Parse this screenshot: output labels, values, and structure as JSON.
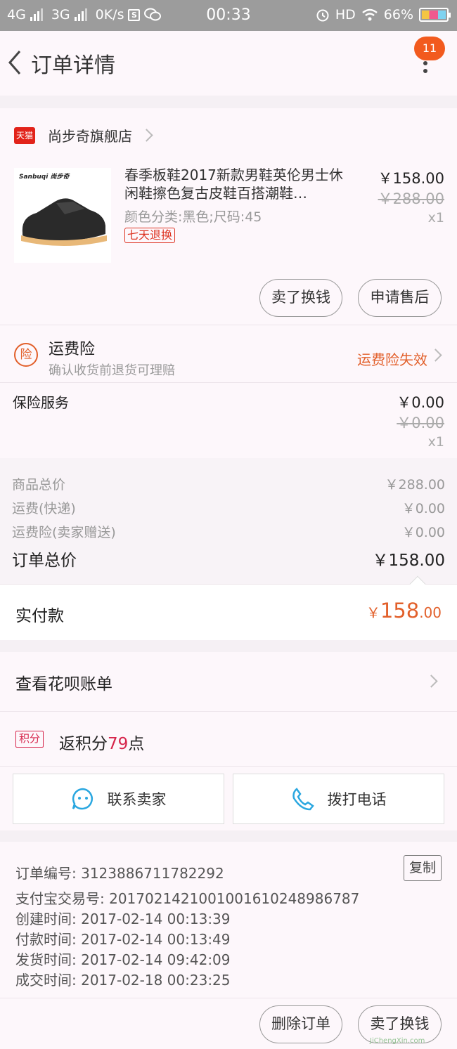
{
  "status_bar": {
    "net1": "4G",
    "net2": "3G",
    "speed": "0K/s",
    "sim_icon": "S",
    "time": "00:33",
    "hd": "HD",
    "battery": "66%"
  },
  "header": {
    "title": "订单详情",
    "badge": "11"
  },
  "shop": {
    "badge": "天猫",
    "name": "尚步奇旗舰店"
  },
  "product": {
    "image_brand": "Sanbuqi 尚步奇",
    "title": "春季板鞋2017新款男鞋英伦男士休闲鞋擦色复古皮鞋百搭潮鞋…",
    "attributes": "颜色分类:黑色;尺码:45",
    "tag": "七天退换",
    "price": "￥158.00",
    "original_price": "￥288.00",
    "qty": "x1"
  },
  "product_actions": {
    "sell": "卖了换钱",
    "after_sale": "申请售后"
  },
  "freight_insurance": {
    "icon": "险",
    "title": "运费险",
    "subtitle": "确认收货前退货可理赔",
    "status": "运费险失效"
  },
  "insurance_service": {
    "label": "保险服务",
    "price": "￥0.00",
    "original_price": "￥0.00",
    "qty": "x1"
  },
  "summary": {
    "rows": [
      {
        "label": "商品总价",
        "value": "￥288.00"
      },
      {
        "label": "运费(快递)",
        "value": "￥0.00"
      },
      {
        "label": "运费险(卖家赠送)",
        "value": "￥0.00"
      }
    ],
    "total_label": "订单总价",
    "total_value": "￥158.00"
  },
  "payment": {
    "label": "实付款",
    "currency": "￥",
    "integer": "158",
    "decimal": ".00"
  },
  "huabei": {
    "label": "查看花呗账单"
  },
  "points": {
    "badge": "积分",
    "prefix": "返积分",
    "amount": "79",
    "suffix": "点"
  },
  "contact": {
    "seller": "联系卖家",
    "phone": "拨打电话"
  },
  "order_info": {
    "lines": [
      "订单编号: 3123886711782292",
      "支付宝交易号: 2017021421001001610248986787",
      "创建时间: 2017-02-14 00:13:39",
      "付款时间: 2017-02-14 00:13:49",
      "发货时间: 2017-02-14 09:42:09",
      "成交时间: 2017-02-18 00:23:25"
    ],
    "copy": "复制"
  },
  "bottom_actions": {
    "delete": "删除订单",
    "sell": "卖了换钱"
  },
  "watermark": "JiChengXin.com",
  "colors": {
    "accent": "#e2602b",
    "tmall_red": "#e2231a",
    "badge_orange": "#f25a1e",
    "points_red": "#d6254b",
    "icon_blue": "#2aa7e0"
  }
}
